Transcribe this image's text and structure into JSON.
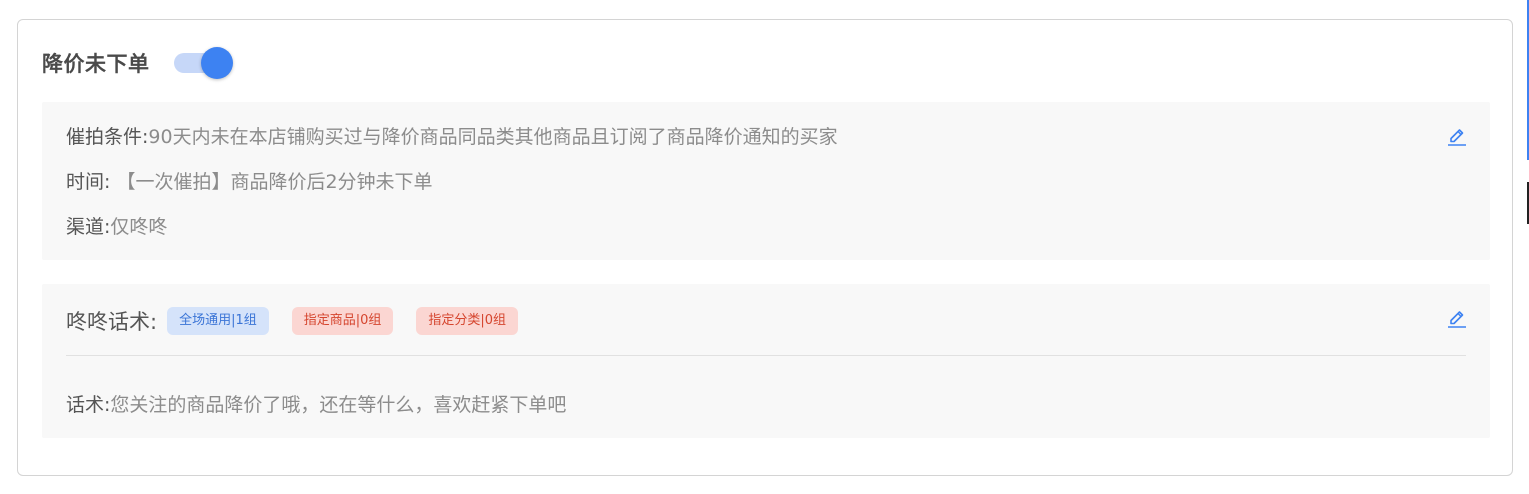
{
  "header": {
    "title": "降价未下单",
    "toggle_on": true
  },
  "conditions": {
    "condition_label": "催拍条件:",
    "condition_value": "90天内未在本店铺购买过与降价商品同品类其他商品且订阅了商品降价通知的买家",
    "time_label": "时间:",
    "time_value": "【一次催拍】商品降价后2分钟未下单",
    "channel_label": "渠道:",
    "channel_value": "仅咚咚",
    "edit_icon": "pencil-icon"
  },
  "scripts": {
    "label": "咚咚话术:",
    "tags": [
      {
        "text": "全场通用|1组",
        "color": "blue"
      },
      {
        "text": "指定商品|0组",
        "color": "red"
      },
      {
        "text": "指定分类|0组",
        "color": "red"
      }
    ],
    "script_label": "话术:",
    "script_value": "您关注的商品降价了哦，还在等什么，喜欢赶紧下单吧",
    "edit_icon": "pencil-icon"
  },
  "colors": {
    "accent": "#3d82f2",
    "tag_blue_bg": "#d5e3fa",
    "tag_red_bg": "#fbd6d2",
    "tag_red_text": "#d5452e"
  }
}
